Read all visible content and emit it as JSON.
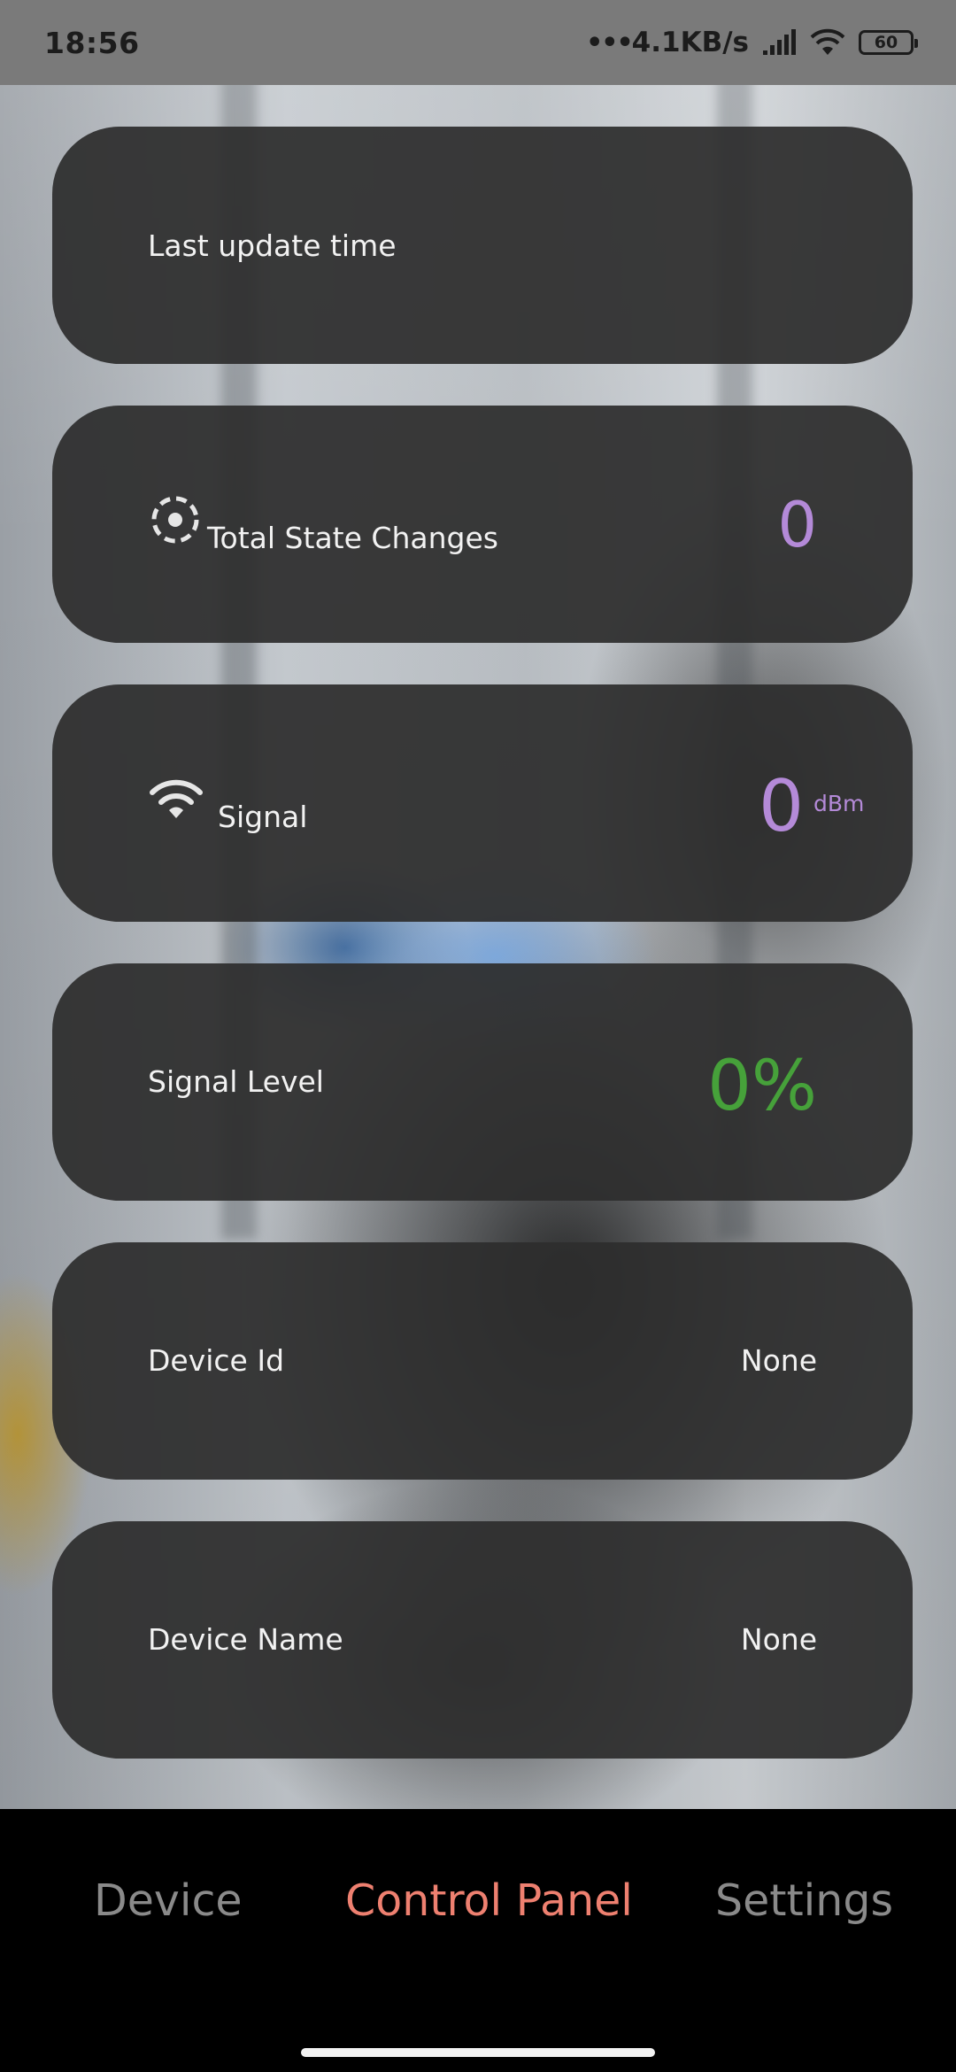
{
  "status_bar": {
    "time": "18:56",
    "dots": "•••",
    "network_speed": "4.1KB/s",
    "battery": "60"
  },
  "cards": {
    "last_update": {
      "label": "Last update time",
      "value": ""
    },
    "state_changes": {
      "label": "Total State Changes",
      "value": "0",
      "icon": "dashed-circle-icon"
    },
    "signal": {
      "label": "Signal",
      "value": "0",
      "unit": "dBm",
      "icon": "wifi-icon"
    },
    "signal_level": {
      "label": "Signal Level",
      "value": "0%"
    },
    "device_id": {
      "label": "Device Id",
      "value": "None"
    },
    "device_name": {
      "label": "Device Name",
      "value": "None"
    }
  },
  "colors": {
    "value_purple": "#b48ad8",
    "value_green": "#46a13a",
    "nav_active": "#ee8070",
    "nav_inactive": "#8a8a8a"
  },
  "nav": {
    "items": [
      {
        "label": "Device",
        "active": false
      },
      {
        "label": "Control Panel",
        "active": true
      },
      {
        "label": "Settings",
        "active": false
      }
    ]
  }
}
